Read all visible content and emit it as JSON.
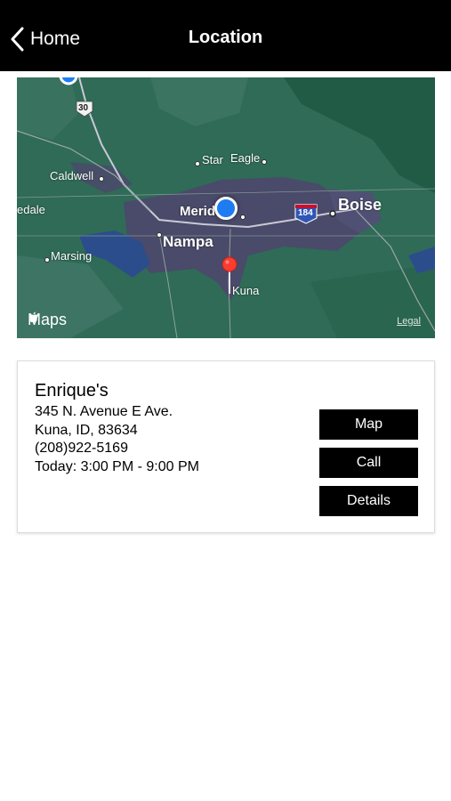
{
  "nav": {
    "back_label": "Home",
    "title": "Location"
  },
  "map": {
    "labels": {
      "star": "Star",
      "eagle": "Eagle",
      "caldwell": "Caldwell",
      "meridian": "Merid",
      "boise": "Boise",
      "nampa": "Nampa",
      "edale": "edale",
      "marsing": "Marsing",
      "kuna": "Kuna",
      "hwy30": "30",
      "i184": "184"
    },
    "brand": "Maps",
    "legal": "Legal",
    "colors": {
      "terrain": "#2f6b57",
      "urban": "#4a4a6a",
      "water": "#2c4d8c",
      "pin": "#ff3b30",
      "user_dot": "#1e7cf2"
    }
  },
  "location": {
    "name": "Enrique's",
    "address_line1": "345 N. Avenue E Ave.",
    "address_line2": "Kuna, ID, 83634",
    "phone": "(208)922-5169",
    "hours": "Today: 3:00 PM - 9:00 PM"
  },
  "buttons": {
    "map": "Map",
    "call": "Call",
    "details": "Details"
  }
}
